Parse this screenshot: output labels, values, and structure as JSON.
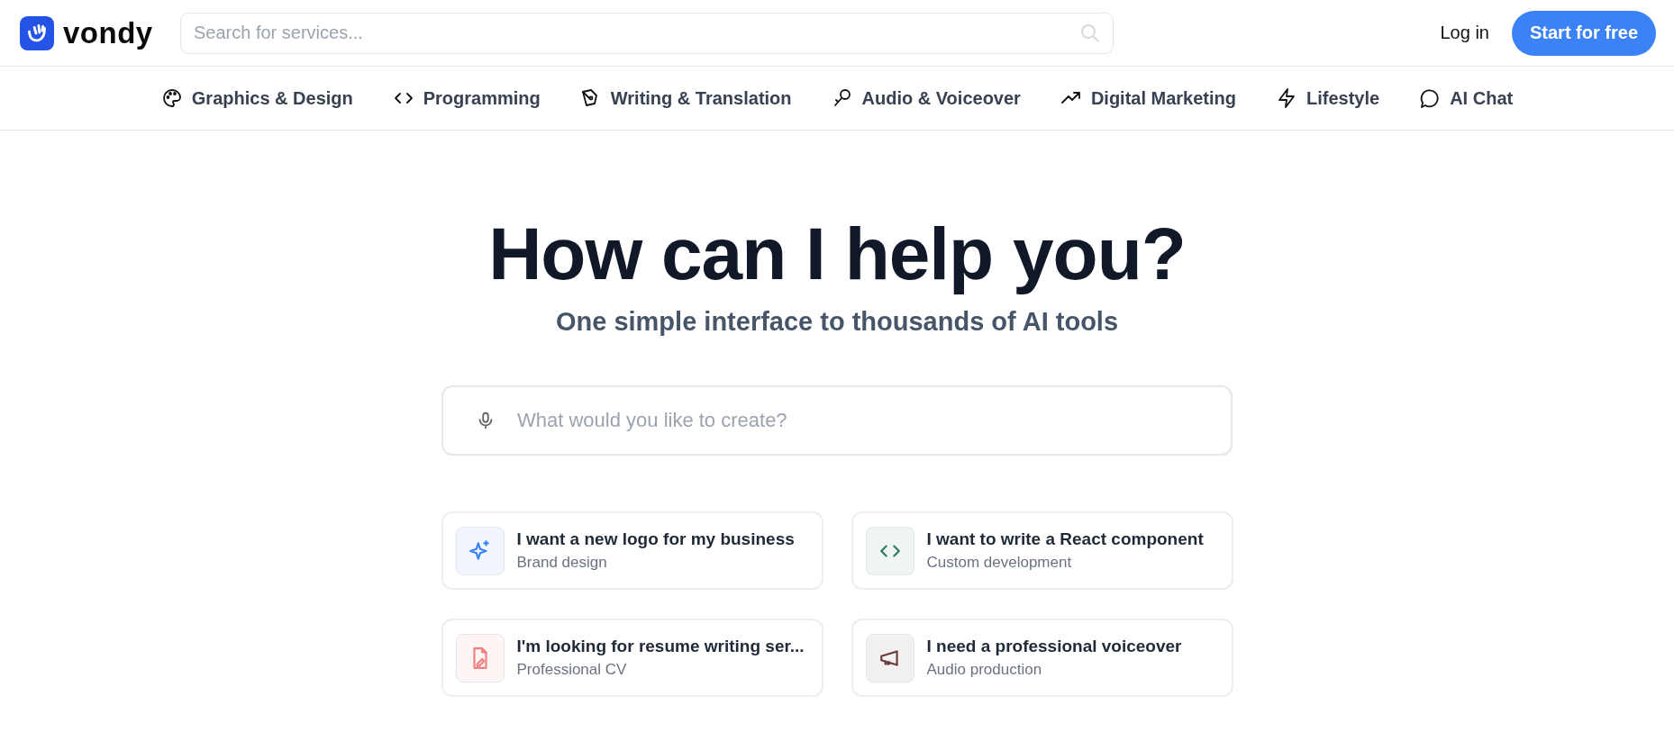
{
  "header": {
    "logo": "vondy",
    "search": {
      "placeholder": "Search for services..."
    },
    "login": "Log in",
    "cta": "Start for free"
  },
  "nav": [
    {
      "label": "Graphics & Design"
    },
    {
      "label": "Programming"
    },
    {
      "label": "Writing & Translation"
    },
    {
      "label": "Audio & Voiceover"
    },
    {
      "label": "Digital Marketing"
    },
    {
      "label": "Lifestyle"
    },
    {
      "label": "AI Chat"
    }
  ],
  "hero": {
    "title": "How can I help you?",
    "subtitle": "One simple interface to thousands of AI tools"
  },
  "prompt": {
    "placeholder": "What would you like to create?"
  },
  "suggestions": [
    {
      "color": "#3b82f6",
      "title": "I want a new logo for my business",
      "subtitle": "Brand design"
    },
    {
      "color": "#2f7a5e",
      "title": "I want to write a React component",
      "subtitle": "Custom development"
    },
    {
      "color": "#f08080",
      "title": "I'm looking for resume writing ser...",
      "subtitle": "Professional CV"
    },
    {
      "color": "#6b3b3b",
      "title": "I need a professional voiceover",
      "subtitle": "Audio production"
    }
  ]
}
